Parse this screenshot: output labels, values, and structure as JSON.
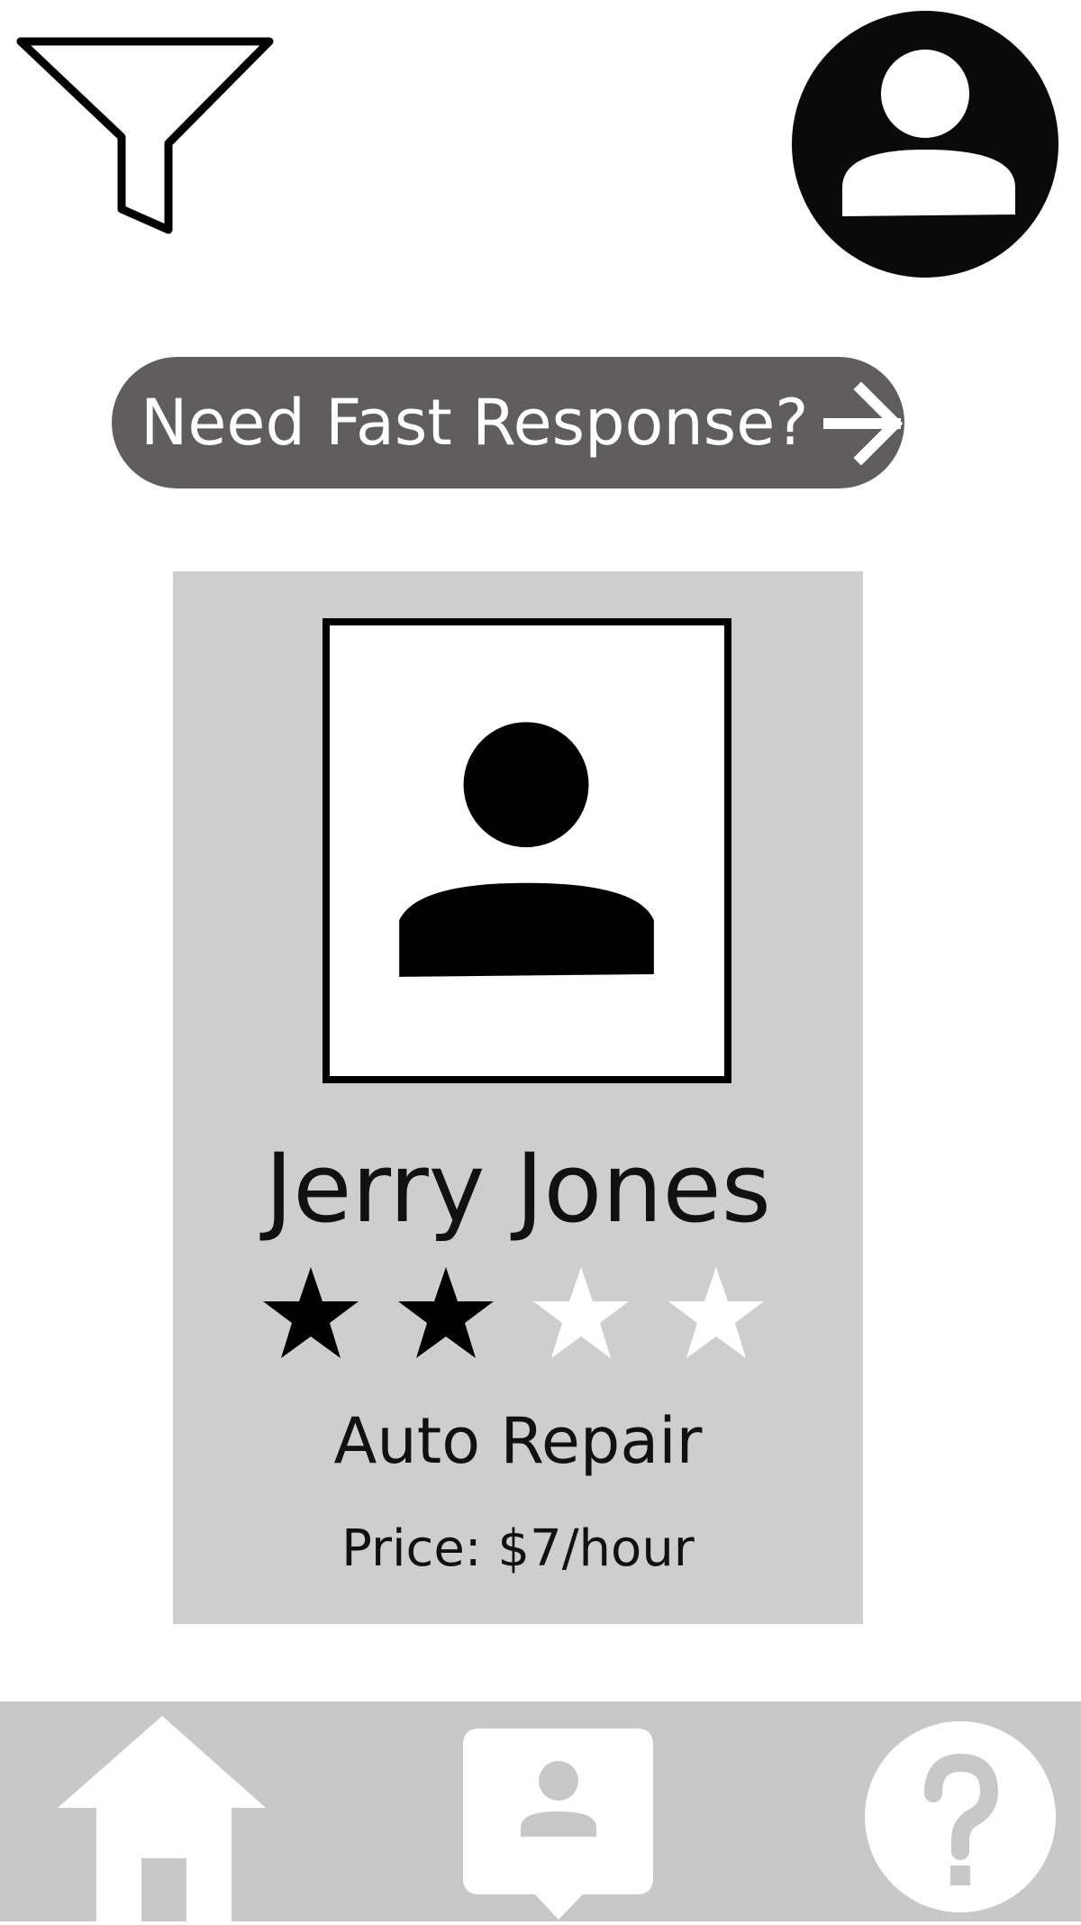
{
  "header": {
    "filter_icon": "filter-funnel-icon",
    "profile_icon": "user-avatar-icon"
  },
  "promo": {
    "label": "Need Fast Response?",
    "icon": "arrow-right-icon"
  },
  "provider_card": {
    "name": "Jerry Jones",
    "rating": 2,
    "rating_max": 4,
    "category": "Auto Repair",
    "price": "Price: $7/hour",
    "photo_icon": "person-placeholder-icon"
  },
  "bottom_nav": {
    "items": [
      {
        "icon": "home-icon"
      },
      {
        "icon": "contact-chat-icon"
      },
      {
        "icon": "help-icon"
      }
    ]
  },
  "colors": {
    "card_bg": "#cecece",
    "button_bg": "#5f5d5e",
    "nav_bg": "#c8c8c8",
    "star_filled": "#000000",
    "star_empty": "#ffffff"
  }
}
